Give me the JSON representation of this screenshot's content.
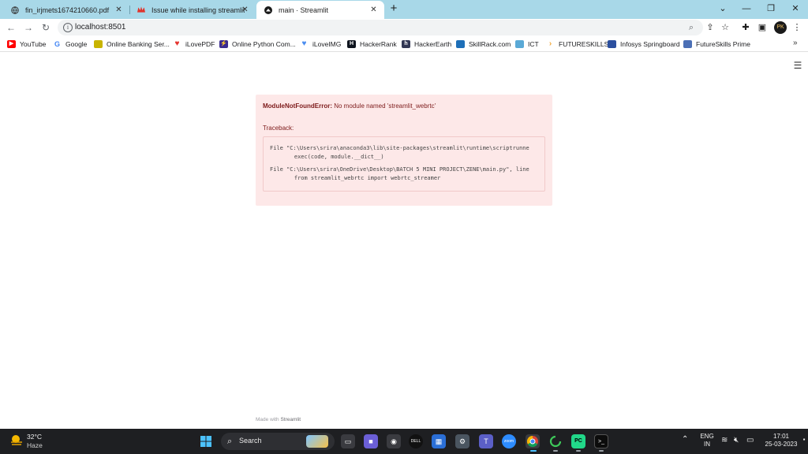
{
  "tabs": [
    {
      "title": "fin_irjmets1674210660.pdf",
      "icon": "globe-icon",
      "active": false
    },
    {
      "title": "Issue while installing streamlit we",
      "icon": "streamlit-crown-icon",
      "active": false
    },
    {
      "title": "main · Streamlit",
      "icon": "streamlit-logo-icon",
      "active": true
    }
  ],
  "browser": {
    "url": "localhost:8501",
    "profile_initials": "PK"
  },
  "bookmarks": [
    {
      "label": "YouTube",
      "color": "#ff0000"
    },
    {
      "label": "Google",
      "color": "#4285f4"
    },
    {
      "label": "Online Banking Ser...",
      "color": "#c8b400"
    },
    {
      "label": "iLovePDF",
      "color": "#e5322d"
    },
    {
      "label": "Online Python Com...",
      "color": "#3b2b8f"
    },
    {
      "label": "iLoveIMG",
      "color": "#4a8df0"
    },
    {
      "label": "HackerRank",
      "color": "#0e141e"
    },
    {
      "label": "HackerEarth",
      "color": "#323754"
    },
    {
      "label": "SkillRack.com",
      "color": "#1d6fb8"
    },
    {
      "label": "ICT",
      "color": "#5aa9d6"
    },
    {
      "label": "FUTURESKILLS",
      "color": "#f2a83b"
    },
    {
      "label": "Infosys Springboard",
      "color": "#2b4f9e"
    },
    {
      "label": "FutureSkills Prime",
      "color": "#4b6fb5"
    }
  ],
  "error": {
    "type": "ModuleNotFoundError:",
    "message": " No module named 'streamlit_webrtc'",
    "traceback_label": "Traceback:",
    "lines": [
      "File \"C:\\Users\\srira\\anaconda3\\lib\\site-packages\\streamlit\\runtime\\scriptrunne",
      "    exec(code, module.__dict__)",
      "File \"C:\\Users\\srira\\OneDrive\\Desktop\\BATCH 5 MINI PROJECT\\ZENE\\main.py\", line",
      "    from streamlit_webrtc import webrtc_streamer"
    ]
  },
  "footer": {
    "prefix": "Made with",
    "brand": "Streamlit"
  },
  "taskbar": {
    "temperature": "32°C",
    "condition": "Haze",
    "search_label": "Search",
    "language_top": "ENG",
    "language_bottom": "IN",
    "time": "17:01",
    "date": "25-03-2023"
  }
}
